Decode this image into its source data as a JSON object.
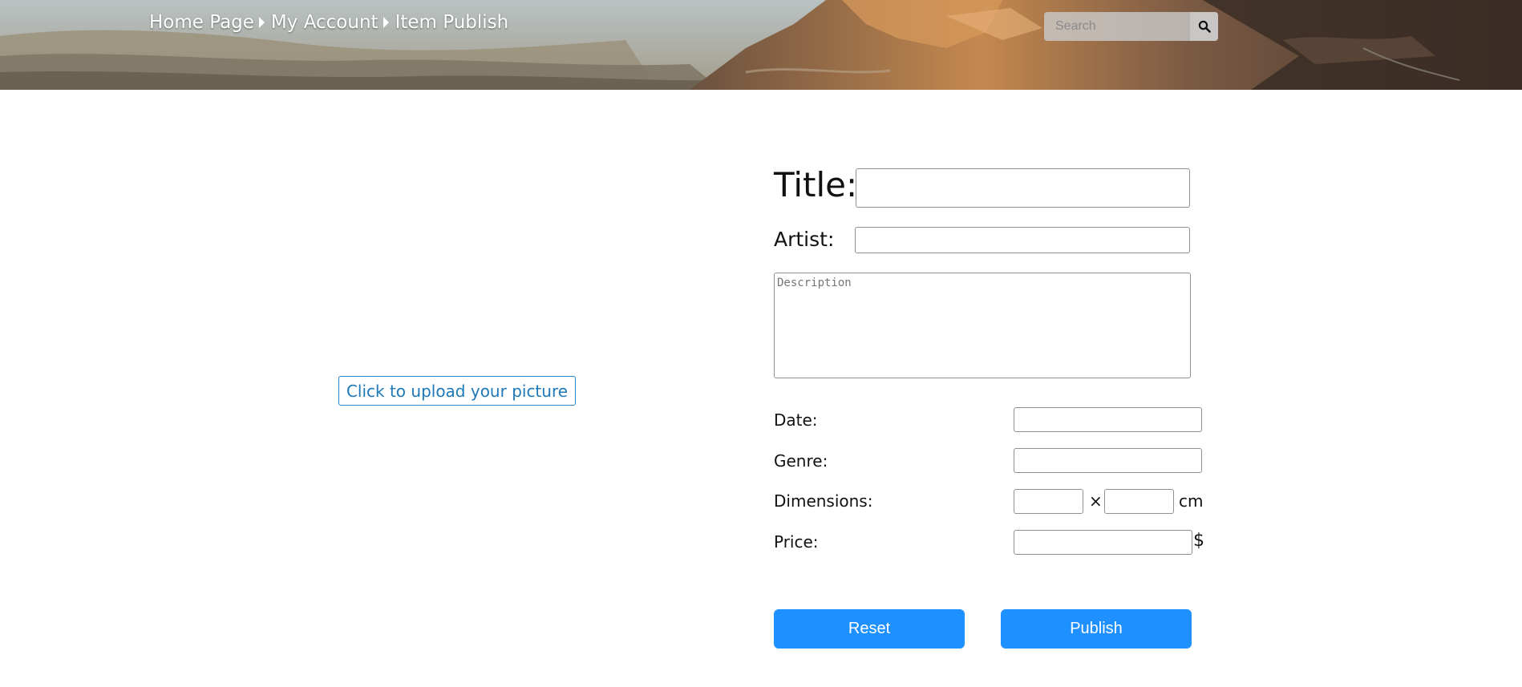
{
  "header": {
    "breadcrumb": [
      "Home Page",
      "My Account",
      "Item Publish"
    ],
    "search": {
      "placeholder": "Search"
    }
  },
  "upload": {
    "label": "Click to upload your picture"
  },
  "form": {
    "title_label": "Title:",
    "artist_label": "Artist:",
    "description_placeholder": "Description",
    "date_label": "Date:",
    "genre_label": "Genre:",
    "dimensions_label": "Dimensions:",
    "dimensions_separator": "×",
    "dimensions_unit": "cm",
    "price_label": "Price:",
    "price_unit": "$",
    "title_value": "",
    "artist_value": "",
    "date_value": "",
    "genre_value": "",
    "width_value": "",
    "height_value": "",
    "price_value": ""
  },
  "actions": {
    "reset_label": "Reset",
    "publish_label": "Publish"
  },
  "colors": {
    "accent": "#1e90ff",
    "upload_border": "#2a86c5",
    "upload_text": "#1d78b8"
  }
}
